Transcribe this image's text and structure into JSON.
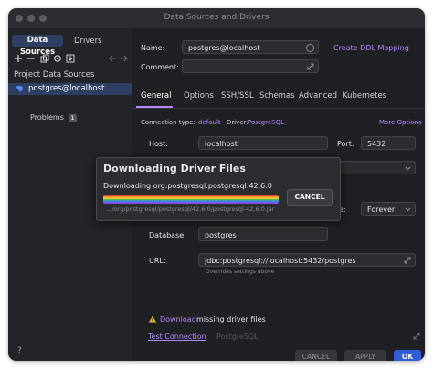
{
  "window": {
    "title": "Data Sources and Drivers"
  },
  "sidebar": {
    "tabs": [
      "Data Sources",
      "Drivers"
    ],
    "section_label": "Project Data Sources",
    "items": [
      {
        "label": "postgres@localhost"
      }
    ],
    "problems": {
      "label": "Problems",
      "count": "1"
    },
    "help": "?"
  },
  "form": {
    "name_label": "Name:",
    "name_value": "postgres@localhost",
    "create_ddl_link": "Create DDL Mapping",
    "comment_label": "Comment:",
    "tabs": [
      "General",
      "Options",
      "SSH/SSL",
      "Schemas",
      "Advanced",
      "Kubernetes"
    ],
    "connection_type_label": "Connection type:",
    "connection_type_value": "default",
    "driver_label": "Driver:",
    "driver_value": "PostgreSQL",
    "more_options": "More Options",
    "host_label": "Host:",
    "host_value": "localhost",
    "port_label": "Port:",
    "port_value": "5432",
    "save_suffix": "e:",
    "save_value": "Forever",
    "database_label": "Database:",
    "database_value": "postgres",
    "url_label": "URL:",
    "url_value": "jdbc:postgresql://localhost:5432/postgres",
    "url_hint": "Overrides settings above",
    "download_link": "Download",
    "download_text": "missing driver files",
    "test_connection": "Test Connection",
    "test_driver": "PostgreSQL"
  },
  "dialog": {
    "title": "Downloading Driver Files",
    "status": "Downloading org.postgresql:postgresql:42.6.0",
    "cancel_label": "CANCEL",
    "path": "…/org/postgresql/postgresql/42.6.0/postgresql-42.6.0.jar"
  },
  "footer": {
    "cancel": "CANCEL",
    "apply": "APPLY",
    "ok": "OK"
  },
  "colors": {
    "accent": "#b587ff",
    "primary_button": "#2f5fd6",
    "selection": "#2f3f63"
  },
  "icons": [
    "add-icon",
    "remove-icon",
    "copy-icon",
    "settings-icon",
    "import-icon",
    "back-icon",
    "forward-icon",
    "postgres-icon",
    "expand-icon",
    "warning-icon",
    "dropdown-icon",
    "chevron-right-icon"
  ]
}
